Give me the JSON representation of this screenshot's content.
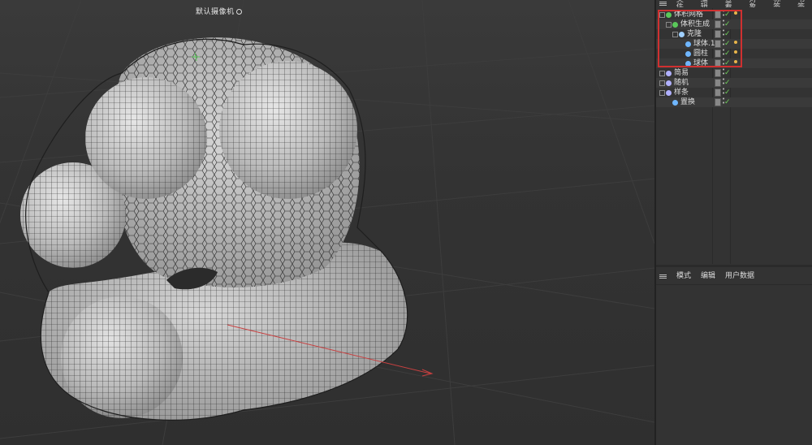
{
  "viewport": {
    "camera_label": "默认摄像机",
    "camera_icon": "camera-dots-icon"
  },
  "object_manager": {
    "menu": [
      {
        "label": "文件"
      },
      {
        "label": "编辑"
      },
      {
        "label": "查看"
      },
      {
        "label": "对象"
      },
      {
        "label": "标签"
      },
      {
        "label": "书签"
      }
    ],
    "tree": [
      {
        "label": "体积网格",
        "depth": 0,
        "icon": "volume-mesher-icon",
        "icon_color": "#5ac85a",
        "expand": "−",
        "tag": true
      },
      {
        "label": "体积生成",
        "depth": 1,
        "icon": "volume-builder-icon",
        "icon_color": "#5ac85a",
        "expand": "−",
        "tag": false
      },
      {
        "label": "克隆",
        "depth": 2,
        "icon": "cloner-icon",
        "icon_color": "#a0d0ff",
        "expand": "−",
        "tag": false
      },
      {
        "label": "球体.1",
        "depth": 3,
        "icon": "sphere-icon",
        "icon_color": "#6fb6ff",
        "expand": "",
        "tag": true
      },
      {
        "label": "圆柱",
        "depth": 3,
        "icon": "cylinder-icon",
        "icon_color": "#6fb6ff",
        "expand": "",
        "tag": true
      },
      {
        "label": "球体",
        "depth": 3,
        "icon": "sphere-icon",
        "icon_color": "#6fb6ff",
        "expand": "",
        "tag": true
      },
      {
        "label": "简易",
        "depth": 0,
        "icon": "plain-effector-icon",
        "icon_color": "#b0b0ff",
        "expand": "−",
        "tag": false
      },
      {
        "label": "随机",
        "depth": 0,
        "icon": "random-effector-icon",
        "icon_color": "#b0b0ff",
        "expand": "−",
        "tag": false
      },
      {
        "label": "样条",
        "depth": 0,
        "icon": "spline-icon",
        "icon_color": "#b0b0ff",
        "expand": "−",
        "tag": false
      },
      {
        "label": "置换",
        "depth": 1,
        "icon": "displacer-icon",
        "icon_color": "#6fb6ff",
        "expand": "",
        "tag": false
      }
    ]
  },
  "attribute_manager": {
    "menu": [
      {
        "label": "模式"
      },
      {
        "label": "编辑"
      },
      {
        "label": "用户数据"
      }
    ]
  },
  "colors": {
    "viewport_bg": "#333333",
    "mesh_fill": "#b4b4b4",
    "highlight": "#d03030",
    "check": "#6fcf5a"
  }
}
